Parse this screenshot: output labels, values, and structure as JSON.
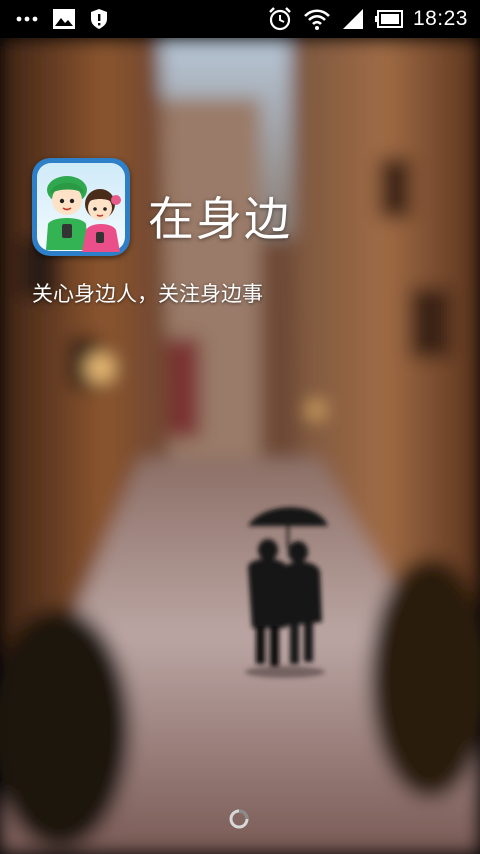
{
  "status_bar": {
    "time": "18:23",
    "icons": [
      "more-dots-icon",
      "image-icon",
      "shield-icon",
      "alarm-icon",
      "wifi-icon",
      "signal-icon",
      "battery-icon"
    ]
  },
  "splash": {
    "app_name": "在身边",
    "slogan": "关心身边人，关注身边事",
    "loading": "spinner"
  },
  "colors": {
    "text": "#ffffff",
    "status_bar_bg": "#000000",
    "icon_frame": "#3a8fd6",
    "scene_wall": "#7a4a2e",
    "scene_street": "#c9b3b0"
  }
}
